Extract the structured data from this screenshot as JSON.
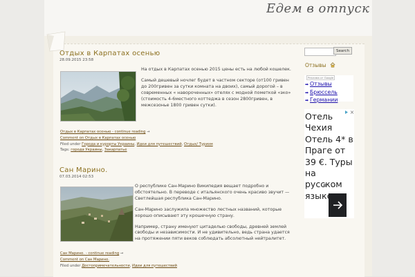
{
  "site": {
    "title": "Едем в отпуск"
  },
  "posts": [
    {
      "title": "Отдых в Карпатах осенью",
      "date": "28.09.2015 23:58",
      "paragraphs": [
        "На отдых в Карпатах осенью 2015 цены есть на любой кошелек.",
        "Самый дешевый ночлег будет в частном секторе (от100 гривен до 200гривен за сутки комната на двоих), самый дорогой – в современных « навороченных» отелях с модной пометкой «эко» (стоимость 4-6местного коттеджа в сезон 2800гривен, в межсезонье 1800 гривен сутки)."
      ],
      "continue_link": "Отдых в Карпатах осенью - continue reading",
      "comment_link": "Comment on Отдых в Карпатах осенью",
      "filed_label": "Filed under",
      "categories": [
        "Города и курорты Украины",
        "Идеи для путешествий",
        "Отдых/ Туризм"
      ],
      "tags_label": "Tags:",
      "tags": [
        "города Украины",
        "Закарпатье"
      ]
    },
    {
      "title": "Сан Марино.",
      "date": "07.03.2014 02:53",
      "paragraphs": [
        "О  республике Сан-Марино Википедия вещает подробно и обстоятельно. В переводе с итальянского очень красиво звучит — Светлейшая республика Сан-Марино.",
        "Сан-Марино заслужила множество лестных названий, которые хорошо описывают эту крошечную страну.",
        "Например, страну именуют цитаделью свободы,  древней землей свободы и независимости. И не удивительно, ведь страна удается  на протяжении пяти веков соблюдать абсолютный нейтралитет."
      ],
      "continue_link": "Сан Марино. - continue reading",
      "comment_link": "Comment on Сан Марино.",
      "filed_label": "Filed under",
      "categories": [
        "Достопримечательности",
        "Идеи для путешествий"
      ]
    }
  ],
  "sidebar": {
    "search_button": "Search",
    "search_placeholder": "",
    "reviews_title": "Отзывы",
    "ad_label": "Реклама от Google",
    "ad_links": [
      "Отзывы",
      "Брюссель",
      "Германии"
    ],
    "ad2_text": "Отель Чехия Отель 4* в Праге от 39 €. Туры на русском языке."
  }
}
